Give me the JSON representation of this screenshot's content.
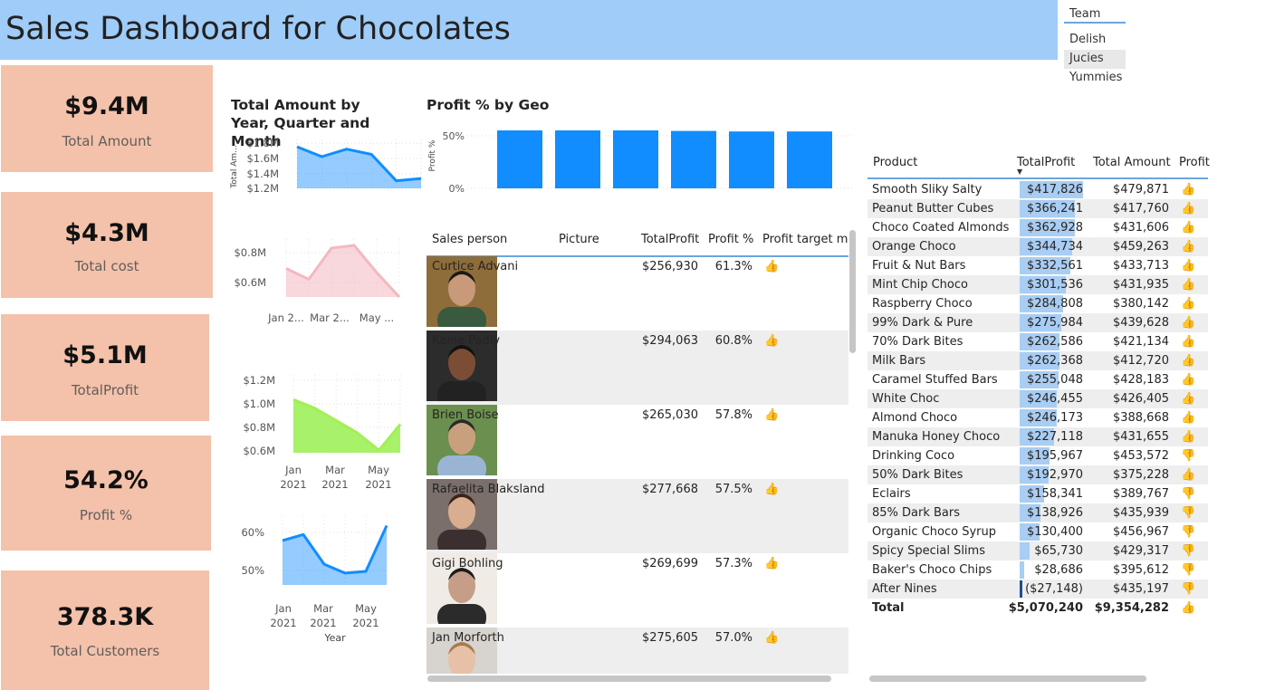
{
  "header": {
    "title": "Sales Dashboard for Chocolates"
  },
  "slicer": {
    "title": "Team",
    "options": [
      "Delish",
      "Jucies",
      "Yummies"
    ],
    "selected": "Jucies"
  },
  "kpis": [
    {
      "value": "$9.4M",
      "label": "Total Amount"
    },
    {
      "value": "$4.3M",
      "label": "Total cost"
    },
    {
      "value": "$5.1M",
      "label": "TotalProfit"
    },
    {
      "value": "54.2%",
      "label": "Profit %"
    },
    {
      "value": "378.3K",
      "label": "Total Customers"
    }
  ],
  "colors": {
    "header_bg": "#9fccf8",
    "kpi_bg": "#f4c1aa",
    "blue": "#118dff",
    "pink": "#f2b8c0",
    "green": "#9ef05a",
    "good": "#e6b31e"
  },
  "icons": {
    "thumbs_up": "👍",
    "thumbs_down": "👎",
    "sort": "▼"
  },
  "chart_data": [
    {
      "type": "area",
      "title": "Total Amount by Year, Quarter and Month",
      "ylabel": "Total Am...",
      "yticks": [
        "$1.8M",
        "$1.6M",
        "$1.4M",
        "$1.2M"
      ],
      "ylim": [
        1.2,
        1.8
      ],
      "series": [
        {
          "values": [
            1.75,
            1.62,
            1.72,
            1.65,
            1.3,
            1.33
          ]
        }
      ],
      "color": "#118dff"
    },
    {
      "type": "area",
      "yticks": [
        "$0.8M",
        "$0.6M"
      ],
      "xticks": [
        "Jan 2...",
        "Mar 2...",
        "May ..."
      ],
      "ylim": [
        0.5,
        0.9
      ],
      "series": [
        {
          "values": [
            0.71,
            0.63,
            0.86,
            0.88,
            0.68,
            0.5
          ]
        }
      ],
      "color": "#f2b8c0"
    },
    {
      "type": "area",
      "yticks": [
        "$1.2M",
        "$1.0M",
        "$0.8M",
        "$0.6M"
      ],
      "xticks": [
        "Jan 2021",
        "Mar 2021",
        "May 2021"
      ],
      "ylim": [
        0.6,
        1.2
      ],
      "series": [
        {
          "values": [
            1.03,
            0.96,
            0.86,
            0.76,
            0.62,
            0.83
          ]
        }
      ],
      "color": "#9ef05a"
    },
    {
      "type": "area",
      "yticks": [
        "60%",
        "50%"
      ],
      "xticks": [
        "Jan 2021",
        "Mar 2021",
        "May 2021"
      ],
      "xlabel": "Year",
      "ylim": [
        43,
        65
      ],
      "series": [
        {
          "values": [
            58,
            60,
            50,
            47,
            47.6,
            63
          ]
        }
      ],
      "color": "#118dff"
    },
    {
      "type": "bar",
      "title": "Profit % by Geo",
      "ylabel": "Profit %",
      "yticks": [
        "50%",
        "0%"
      ],
      "ylim": [
        0,
        50
      ],
      "values": [
        55,
        55,
        55,
        54.5,
        54,
        54
      ],
      "color": "#118dff"
    }
  ],
  "sales_table": {
    "columns": [
      "Sales person",
      "Picture",
      "TotalProfit",
      "Profit %",
      "Profit target me"
    ],
    "rows": [
      {
        "name": "Curtice Advani",
        "profit": "$256,930",
        "pct": "61.3%"
      },
      {
        "name": "Kaine Padly",
        "profit": "$294,063",
        "pct": "60.8%"
      },
      {
        "name": "Brien Boise",
        "profit": "$265,030",
        "pct": "57.8%"
      },
      {
        "name": "Rafaelita Blaksland",
        "profit": "$277,668",
        "pct": "57.5%"
      },
      {
        "name": "Gigi Bohling",
        "profit": "$269,699",
        "pct": "57.3%"
      },
      {
        "name": "Jan Morforth",
        "profit": "$275,605",
        "pct": "57.0%"
      }
    ]
  },
  "product_table": {
    "columns": [
      "Product",
      "TotalProfit",
      "Total Amount",
      "Profit"
    ],
    "rows": [
      {
        "product": "Smooth Sliky Salty",
        "profit": "$417,826",
        "profit_value": 417826,
        "amount": "$479,871",
        "good": true
      },
      {
        "product": "Peanut Butter Cubes",
        "profit": "$366,241",
        "profit_value": 366241,
        "amount": "$417,760",
        "good": true
      },
      {
        "product": "Choco Coated Almonds",
        "profit": "$362,928",
        "profit_value": 362928,
        "amount": "$431,606",
        "good": true
      },
      {
        "product": "Orange Choco",
        "profit": "$344,734",
        "profit_value": 344734,
        "amount": "$459,263",
        "good": true
      },
      {
        "product": "Fruit & Nut Bars",
        "profit": "$332,561",
        "profit_value": 332561,
        "amount": "$433,713",
        "good": true
      },
      {
        "product": "Mint Chip Choco",
        "profit": "$301,536",
        "profit_value": 301536,
        "amount": "$431,935",
        "good": true
      },
      {
        "product": "Raspberry Choco",
        "profit": "$284,808",
        "profit_value": 284808,
        "amount": "$380,142",
        "good": true
      },
      {
        "product": "99% Dark & Pure",
        "profit": "$275,984",
        "profit_value": 275984,
        "amount": "$439,628",
        "good": true
      },
      {
        "product": "70% Dark Bites",
        "profit": "$262,586",
        "profit_value": 262586,
        "amount": "$421,134",
        "good": true
      },
      {
        "product": "Milk Bars",
        "profit": "$262,368",
        "profit_value": 262368,
        "amount": "$412,720",
        "good": true
      },
      {
        "product": "Caramel Stuffed Bars",
        "profit": "$255,048",
        "profit_value": 255048,
        "amount": "$428,183",
        "good": true
      },
      {
        "product": "White Choc",
        "profit": "$246,455",
        "profit_value": 246455,
        "amount": "$426,405",
        "good": true
      },
      {
        "product": "Almond Choco",
        "profit": "$246,173",
        "profit_value": 246173,
        "amount": "$388,668",
        "good": true
      },
      {
        "product": "Manuka Honey Choco",
        "profit": "$227,118",
        "profit_value": 227118,
        "amount": "$431,655",
        "good": true
      },
      {
        "product": "Drinking Coco",
        "profit": "$195,967",
        "profit_value": 195967,
        "amount": "$453,572",
        "good": false
      },
      {
        "product": "50% Dark Bites",
        "profit": "$192,970",
        "profit_value": 192970,
        "amount": "$375,228",
        "good": true
      },
      {
        "product": "Eclairs",
        "profit": "$158,341",
        "profit_value": 158341,
        "amount": "$389,767",
        "good": false
      },
      {
        "product": "85% Dark Bars",
        "profit": "$138,926",
        "profit_value": 138926,
        "amount": "$435,939",
        "good": false
      },
      {
        "product": "Organic Choco Syrup",
        "profit": "$130,400",
        "profit_value": 130400,
        "amount": "$456,967",
        "good": false
      },
      {
        "product": "Spicy Special Slims",
        "profit": "$65,730",
        "profit_value": 65730,
        "amount": "$429,317",
        "good": false
      },
      {
        "product": "Baker's Choco Chips",
        "profit": "$28,686",
        "profit_value": 28686,
        "amount": "$395,612",
        "good": false
      },
      {
        "product": "After Nines",
        "profit": "($27,148)",
        "profit_value": -27148,
        "amount": "$435,197",
        "good": false
      }
    ],
    "total": {
      "label": "Total",
      "profit": "$5,070,240",
      "amount": "$9,354,282"
    }
  }
}
